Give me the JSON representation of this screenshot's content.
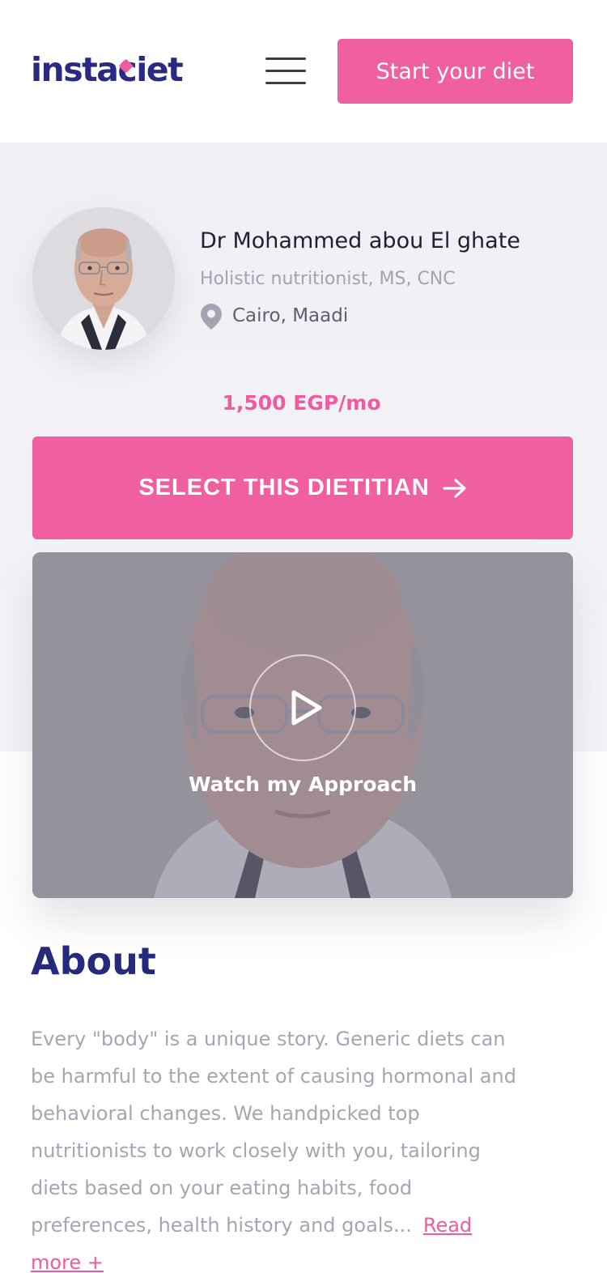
{
  "header": {
    "logo_text_before": "insta",
    "logo_text_after": "iet",
    "start_button_label": "Start your diet"
  },
  "dietitian": {
    "name": "Dr Mohammed abou El ghate",
    "credentials": "Holistic nutritionist, MS, CNC",
    "location": "Cairo, Maadi",
    "price": "1,500 EGP/mo",
    "select_button_label": "SELECT THIS DIETITIAN"
  },
  "video": {
    "label": "Watch my Approach"
  },
  "about": {
    "title": "About",
    "text": "Every \"body\" is a unique story. Generic diets can be harmful to the extent of causing hormonal and behavioral changes. We handpicked top nutritionists to work closely with you, tailoring diets based on your eating habits, food preferences, health history and goals...",
    "read_more_label": "Read more +"
  },
  "colors": {
    "brand_pink": "#f05fa0",
    "brand_navy": "#2a2a85",
    "muted_text": "#a7a5b5"
  },
  "icons": [
    "menu-icon",
    "location-pin-icon",
    "arrow-right-icon",
    "play-icon"
  ]
}
